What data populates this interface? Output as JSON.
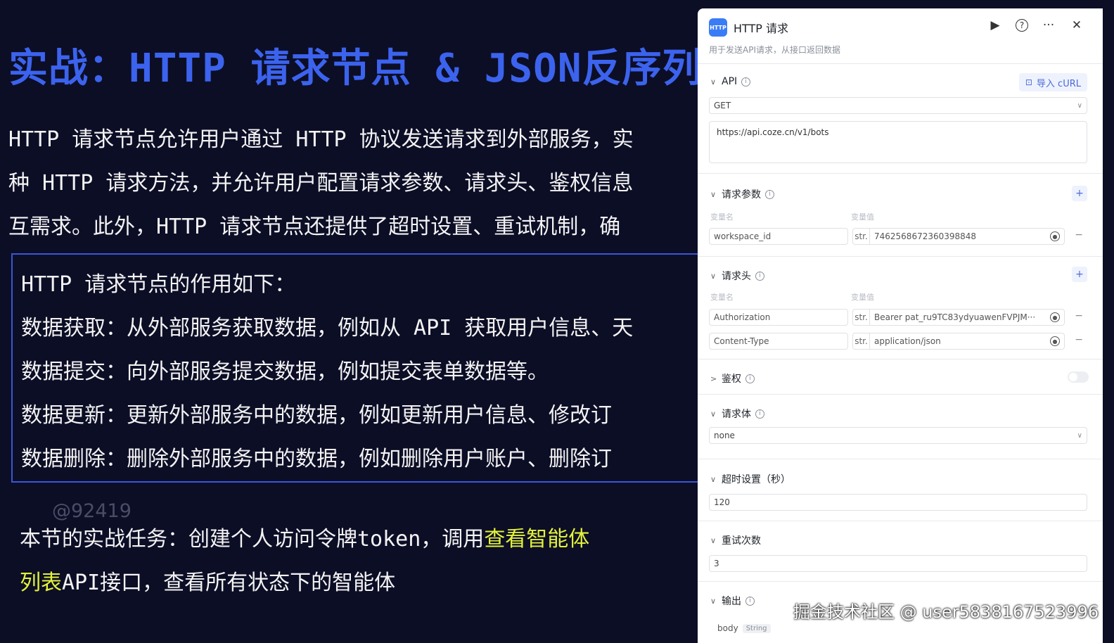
{
  "slide": {
    "title": "实战：HTTP 请求节点 & JSON反序列",
    "paragraph_lines": [
      "HTTP 请求节点允许用户通过 HTTP 协议发送请求到外部服务，实",
      "种 HTTP 请求方法，并允许用户配置请求参数、请求头、鉴权信息",
      "互需求。此外，HTTP 请求节点还提供了超时设置、重试机制，确"
    ],
    "box_lines": [
      "HTTP 请求节点的作用如下：",
      "数据获取：从外部服务获取数据，例如从 API 获取用户信息、天",
      "数据提交：向外部服务提交数据，例如提交表单数据等。",
      "数据更新：更新外部服务中的数据，例如更新用户信息、修改订",
      "数据删除：删除外部服务中的数据，例如删除用户账户、删除订"
    ],
    "watermark": "@92419",
    "task_line1_plain": "本节的实战任务：创建个人访问令牌token，调用",
    "task_line1_highlight": "查看智能体",
    "task_line2_highlight": "列表",
    "task_line2_plain": "API接口，查看所有状态下的智能体"
  },
  "panel": {
    "logo_text": "HTTP",
    "title": "HTTP 请求",
    "description": "用于发送API请求，从接口返回数据",
    "actions": {
      "run": "▶",
      "help": "?",
      "more": "···",
      "close": "✕"
    },
    "api": {
      "label": "API",
      "import_curl": "导入 cURL",
      "method": "GET",
      "url": "https://api.coze.cn/v1/bots"
    },
    "params": {
      "label": "请求参数",
      "col_name": "变量名",
      "col_value": "变量值",
      "rows": [
        {
          "name": "workspace_id",
          "type": "str.",
          "value": "7462568672360398848"
        }
      ]
    },
    "headers": {
      "label": "请求头",
      "col_name": "变量名",
      "col_value": "变量值",
      "rows": [
        {
          "name": "Authorization",
          "type": "str.",
          "value": "Bearer pat_ru9TC83ydyuawenFVPJM···"
        },
        {
          "name": "Content-Type",
          "type": "str.",
          "value": "application/json"
        }
      ]
    },
    "auth": {
      "label": "鉴权",
      "enabled": false
    },
    "body": {
      "label": "请求体",
      "value": "none"
    },
    "timeout": {
      "label": "超时设置（秒）",
      "value": "120"
    },
    "retry": {
      "label": "重试次数",
      "value": "3"
    },
    "output": {
      "label": "输出",
      "field": "body",
      "type": "String"
    }
  },
  "site_watermark": "掘金技术社区 @ user5838167523996"
}
